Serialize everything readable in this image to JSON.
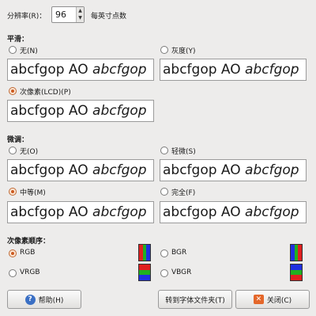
{
  "resolution": {
    "label": "分辨率(R)：",
    "value": "96",
    "unit": "每英寸点数"
  },
  "smoothing": {
    "title": "平滑：",
    "options": [
      {
        "label": "无(N)",
        "selected": false
      },
      {
        "label": "灰度(Y)",
        "selected": false
      },
      {
        "label": "次像素(LCD)(P)",
        "selected": true
      }
    ]
  },
  "hinting": {
    "title": "微调：",
    "options": [
      {
        "label": "无(O)",
        "selected": false
      },
      {
        "label": "轻微(S)",
        "selected": false
      },
      {
        "label": "中等(M)",
        "selected": true
      },
      {
        "label": "完全(F)",
        "selected": false
      }
    ]
  },
  "sample_text": {
    "regular": "abcfgop AO ",
    "italic": "abcfgop"
  },
  "subpixel": {
    "title": "次像素顺序：",
    "options": [
      {
        "label": "RGB",
        "selected": true,
        "colors": [
          "#e02020",
          "#20b020",
          "#2030e0"
        ],
        "orientation": "vertical"
      },
      {
        "label": "BGR",
        "selected": false,
        "colors": [
          "#2030e0",
          "#20b020",
          "#e02020"
        ],
        "orientation": "vertical"
      },
      {
        "label": "VRGB",
        "selected": false,
        "colors": [
          "#e02020",
          "#20b020",
          "#2030e0"
        ],
        "orientation": "horizontal"
      },
      {
        "label": "VBGR",
        "selected": false,
        "colors": [
          "#2030e0",
          "#20b020",
          "#e02020"
        ],
        "orientation": "horizontal"
      }
    ]
  },
  "buttons": {
    "help": "帮助(H)",
    "goto_fonts": "转到字体文件夹(T)",
    "close": "关闭(C)",
    "help_icon": "help-icon",
    "close_icon": "close-icon"
  }
}
